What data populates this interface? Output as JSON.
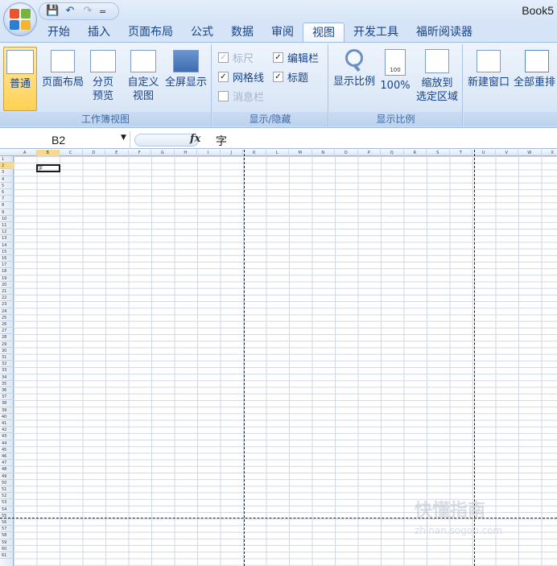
{
  "window": {
    "doc_title": "Book5"
  },
  "quick_access": {
    "separator": "="
  },
  "tabs": [
    {
      "label": "开始"
    },
    {
      "label": "插入"
    },
    {
      "label": "页面布局"
    },
    {
      "label": "公式"
    },
    {
      "label": "数据"
    },
    {
      "label": "审阅"
    },
    {
      "label": "视图",
      "active": true
    },
    {
      "label": "开发工具"
    },
    {
      "label": "福昕阅读器"
    }
  ],
  "ribbon": {
    "workbook_views": {
      "label": "工作簿视图",
      "normal": "普通",
      "page_layout": "页面布局",
      "page_break_1": "分页",
      "page_break_2": "预览",
      "custom_1": "自定义",
      "custom_2": "视图",
      "fullscreen": "全屏显示"
    },
    "show_hide": {
      "label": "显示/隐藏",
      "ruler": "标尺",
      "formula_bar": "编辑栏",
      "gridlines": "网格线",
      "headings": "标题",
      "message_bar": "消息栏",
      "check": "✓"
    },
    "zoom": {
      "label": "显示比例",
      "zoom": "显示比例",
      "hundred": "100%",
      "zoom_sel_1": "缩放到",
      "zoom_sel_2": "选定区域",
      "icon_text": "100"
    },
    "window": {
      "new_window": "新建窗口",
      "arrange_all": "全部重排"
    }
  },
  "formula_bar": {
    "name_box": "B2",
    "fx": "fx",
    "content": "字"
  },
  "sheet": {
    "columns": [
      "A",
      "B",
      "C",
      "D",
      "E",
      "F",
      "G",
      "H",
      "I",
      "J",
      "K",
      "L",
      "M",
      "N",
      "O",
      "P",
      "Q",
      "R",
      "S",
      "T",
      "U",
      "V",
      "W",
      "X"
    ],
    "selected_column": "B",
    "selected_row": 2,
    "active_cell_value": "字",
    "row_count": 61
  },
  "watermark": {
    "title": "快懂指南",
    "url": "zhinan.sogou.com"
  }
}
